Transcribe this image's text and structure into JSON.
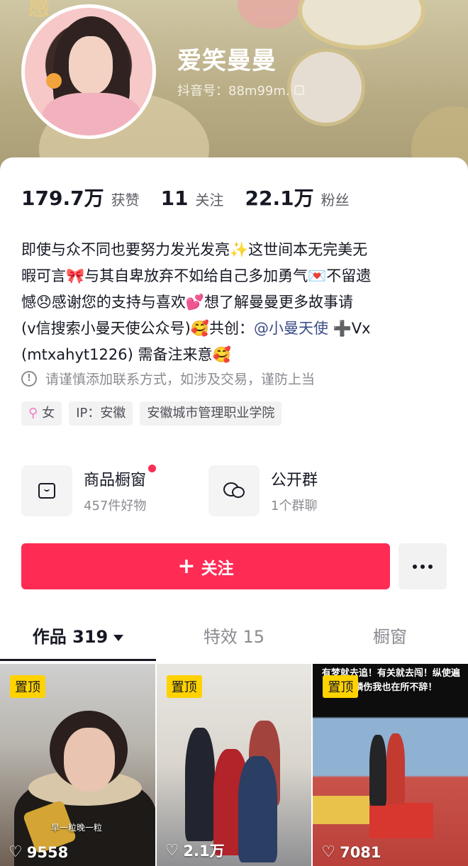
{
  "header": {
    "background_text": "感",
    "nickname": "爱笑曼曼",
    "douyin_id": "抖音号：88m99m."
  },
  "stats": [
    {
      "value": "179.7万",
      "label": "获赞"
    },
    {
      "value": "11",
      "label": "关注"
    },
    {
      "value": "22.1万",
      "label": "粉丝"
    }
  ],
  "bio": {
    "line1": "即使与众不同也要努力发光发亮✨这世间本无完美无",
    "line2": "暇可言🎀与其自卑放弃不如给自己多加勇气💌不留遗",
    "line3": "憾😞感谢您的支持与喜欢💕想了解曼曼更多故事请",
    "line4_before": "(v信搜索小曼天使公众号)🥰共创：",
    "line4_mention": "@小曼天使",
    "line4_after": " ➕Vx",
    "line5": "(mtxahyt1226) 需备注来意🥰"
  },
  "warning": {
    "icon": "!",
    "text": "请谨慎添加联系方式，如涉及交易，谨防上当"
  },
  "tags": {
    "gender": "女",
    "gender_icon": "⚲",
    "ip": "IP：安徽",
    "school": "安徽城市管理职业学院"
  },
  "shortcuts": {
    "shop_title": "商品橱窗",
    "shop_sub": "457件好物",
    "group_title": "公开群",
    "group_sub": "1个群聊"
  },
  "actions": {
    "follow_icon": "+",
    "follow_label": "关注"
  },
  "tabs": [
    {
      "label": "作品 319"
    },
    {
      "label": "特效 15"
    },
    {
      "label": "橱窗"
    }
  ],
  "videos": [
    {
      "pinned": "置顶",
      "likes": "9558",
      "overlay": "早一粒晚一粒"
    },
    {
      "pinned": "置顶",
      "likes": "2.1万",
      "overlay": ""
    },
    {
      "pinned": "置顶",
      "likes": "7081",
      "overlay": "有梦就去追！有关就去闯！纵使遍体鳞伤我也在所不辞！"
    }
  ],
  "icons": {
    "heart": "♡",
    "accent_color": "#fe2c55"
  }
}
